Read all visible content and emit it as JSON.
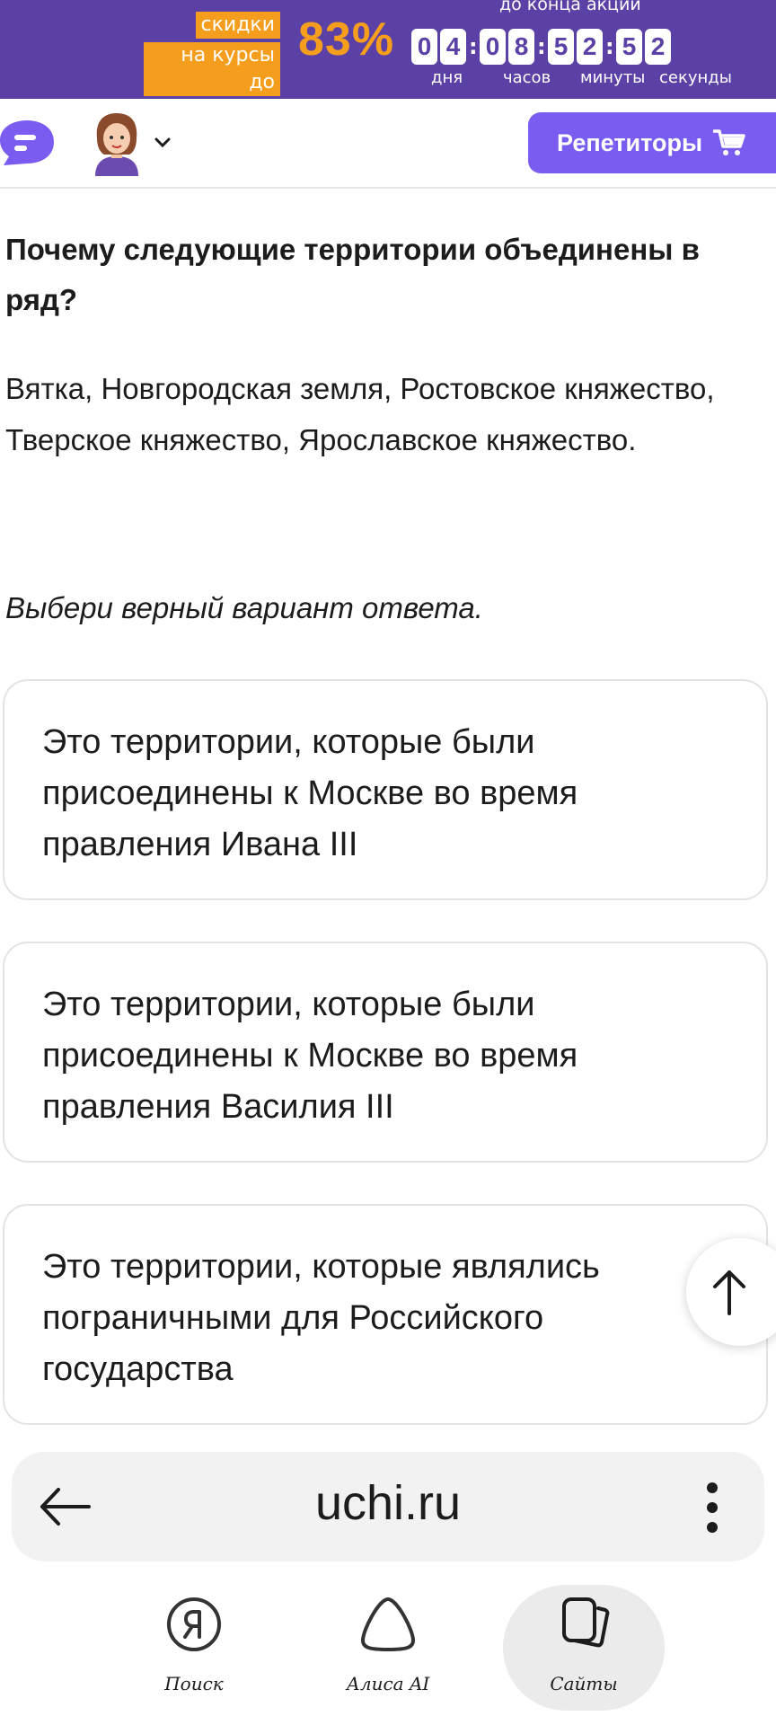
{
  "promo": {
    "badge_line1": "скидки",
    "badge_line2": "на курсы до",
    "percent": "83%",
    "until_label": "до конца акции",
    "timer_digits": [
      "0",
      "4",
      "0",
      "8",
      "5",
      "2",
      "5",
      "2"
    ],
    "labels": {
      "days": "дня",
      "hours": "часов",
      "minutes": "минуты",
      "seconds": "секунды"
    },
    "colors": {
      "background": "#5b40a6",
      "accent": "#f59d1d"
    }
  },
  "header": {
    "chat_icon": "chat-bubble-icon",
    "avatar_icon": "user-avatar-icon",
    "tutors_button": "Репетиторы",
    "cart_icon": "cart-icon",
    "colors": {
      "button": "#7b5cf0"
    }
  },
  "task": {
    "title": "Почему следующие территории объединены в ряд?",
    "text": "Вятка, Новгородская земля, Ростовское княжество, Тверское княжество, Ярославское княжество.",
    "instruction": "Выбери верный вариант ответа.",
    "options": [
      "Это территории, которые были присоединены к Москве во время правления Ивана III",
      "Это территории, которые были присоединены к Москве во время правления Василия III",
      "Это территории, которые являлись пограничными для Российского государства"
    ]
  },
  "scroll_up_icon": "arrow-up-icon",
  "browser": {
    "url": "uchi.ru",
    "back_icon": "arrow-left-icon",
    "menu_icon": "more-vertical-icon"
  },
  "bottom_nav": {
    "items": [
      {
        "label": "Поиск",
        "icon": "yandex-search-icon"
      },
      {
        "label": "Алиса AI",
        "icon": "alice-icon"
      },
      {
        "label": "Сайты",
        "icon": "sites-cards-icon",
        "active": true
      }
    ]
  }
}
